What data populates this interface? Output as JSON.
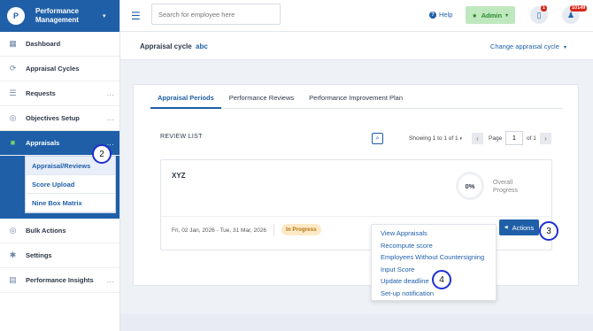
{
  "brand": {
    "title": "Performance Management",
    "logo": "P"
  },
  "sidebar": {
    "items": [
      {
        "label": "Dashboard",
        "icon": "grid-icon",
        "more": ""
      },
      {
        "label": "Appraisal Cycles",
        "icon": "cycle-icon",
        "more": ""
      },
      {
        "label": "Requests",
        "icon": "list-icon",
        "more": "..."
      },
      {
        "label": "Objectives Setup",
        "icon": "target-icon",
        "more": "..."
      },
      {
        "label": "Appraisals",
        "icon": "book-icon",
        "more": "..."
      },
      {
        "label": "Bulk Actions",
        "icon": "target-icon",
        "more": ""
      },
      {
        "label": "Settings",
        "icon": "gear-icon",
        "more": ""
      },
      {
        "label": "Performance Insights",
        "icon": "chart-icon",
        "more": "..."
      }
    ],
    "submenu": [
      "Appraisal/Reviews",
      "Score Upload",
      "Nine Box Matrix"
    ]
  },
  "steps": [
    "2",
    "3",
    "4"
  ],
  "topbar": {
    "search_placeholder": "Search for employee here",
    "help": "Help",
    "admin": "Admin",
    "clipboard_badge": "1",
    "bell_badge": "10149"
  },
  "cycle": {
    "label": "Appraisal cycle",
    "value": "abc",
    "change": "Change appraisal cycle"
  },
  "tabs": [
    "Appraisal Periods",
    "Performance Reviews",
    "Performance Improvement Plan"
  ],
  "list": {
    "title": "REVIEW LIST",
    "showing": "Showing 1 to 1 of 1",
    "page_label": "Page",
    "page_value": "1",
    "of_label": "of 1"
  },
  "review": {
    "name": "XYZ",
    "progress": "0%",
    "progress_label": "Overall Progress",
    "dates": "Fri, 02 Jan, 2026 - Tue, 31 Mar, 2026",
    "status": "In Progress",
    "actions": "Actions"
  },
  "dropdown": [
    "View Appraisals",
    "Recompute score",
    "Employees Without Countersigning",
    "Input Score",
    "Update deadline",
    "Set-up notification"
  ],
  "colors": {
    "primary": "#1f5fa8",
    "active_green": "#6fd36f",
    "status_bg": "#fde9c6",
    "step_ring": "#1d2fd0"
  }
}
